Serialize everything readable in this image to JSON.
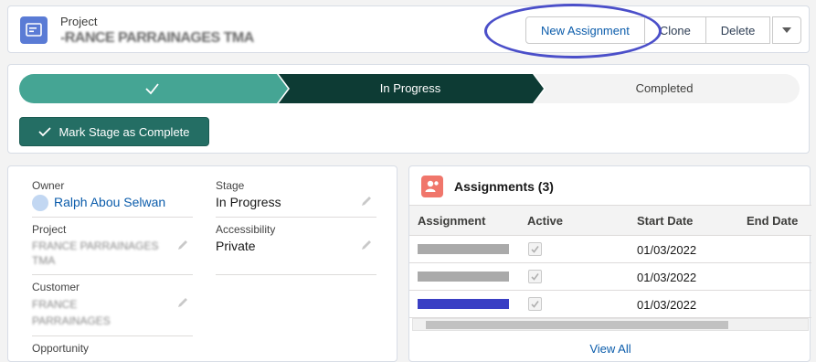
{
  "header": {
    "object_type": "Project",
    "record_title": "-RANCE PARRAINAGES TMA",
    "buttons": {
      "new_assignment": "New Assignment",
      "clone": "Clone",
      "delete": "Delete"
    },
    "icon": "project-icon",
    "more_icon": "chevron-down-icon"
  },
  "path": {
    "steps": [
      {
        "label": "",
        "state": "complete",
        "icon": "check-icon"
      },
      {
        "label": "In Progress",
        "state": "current"
      },
      {
        "label": "Completed",
        "state": "incomplete"
      }
    ],
    "mark_complete_label": "Mark Stage as Complete",
    "colors": {
      "complete": "#45a594",
      "current": "#0d3b34",
      "incomplete": "#f3f3f3",
      "button": "#246e64"
    }
  },
  "details": {
    "owner": {
      "label": "Owner",
      "value": "Ralph Abou Selwan"
    },
    "stage": {
      "label": "Stage",
      "value": "In Progress"
    },
    "project": {
      "label": "Project",
      "value": "FRANCE PARRAINAGES TMA"
    },
    "accessibility": {
      "label": "Accessibility",
      "value": "Private"
    },
    "customer": {
      "label": "Customer",
      "value": "FRANCE PARRAINAGES"
    },
    "opportunity": {
      "label": "Opportunity"
    }
  },
  "assignments": {
    "title": "Assignments (3)",
    "columns": [
      "Assignment",
      "Active",
      "Start Date",
      "End Date"
    ],
    "rows": [
      {
        "start_date": "01/03/2022",
        "active": true
      },
      {
        "start_date": "01/03/2022",
        "active": true
      },
      {
        "start_date": "01/03/2022",
        "active": true
      }
    ],
    "view_all": "View All"
  }
}
